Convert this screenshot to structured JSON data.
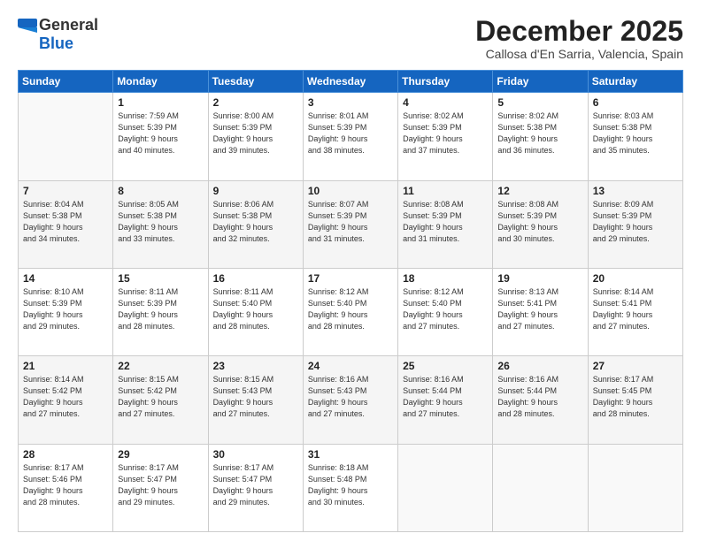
{
  "header": {
    "logo_general": "General",
    "logo_blue": "Blue",
    "month": "December 2025",
    "location": "Callosa d'En Sarria, Valencia, Spain"
  },
  "days_header": [
    "Sunday",
    "Monday",
    "Tuesday",
    "Wednesday",
    "Thursday",
    "Friday",
    "Saturday"
  ],
  "weeks": [
    {
      "shade": false,
      "days": [
        {
          "num": "",
          "info": ""
        },
        {
          "num": "1",
          "info": "Sunrise: 7:59 AM\nSunset: 5:39 PM\nDaylight: 9 hours\nand 40 minutes."
        },
        {
          "num": "2",
          "info": "Sunrise: 8:00 AM\nSunset: 5:39 PM\nDaylight: 9 hours\nand 39 minutes."
        },
        {
          "num": "3",
          "info": "Sunrise: 8:01 AM\nSunset: 5:39 PM\nDaylight: 9 hours\nand 38 minutes."
        },
        {
          "num": "4",
          "info": "Sunrise: 8:02 AM\nSunset: 5:39 PM\nDaylight: 9 hours\nand 37 minutes."
        },
        {
          "num": "5",
          "info": "Sunrise: 8:02 AM\nSunset: 5:38 PM\nDaylight: 9 hours\nand 36 minutes."
        },
        {
          "num": "6",
          "info": "Sunrise: 8:03 AM\nSunset: 5:38 PM\nDaylight: 9 hours\nand 35 minutes."
        }
      ]
    },
    {
      "shade": true,
      "days": [
        {
          "num": "7",
          "info": "Sunrise: 8:04 AM\nSunset: 5:38 PM\nDaylight: 9 hours\nand 34 minutes."
        },
        {
          "num": "8",
          "info": "Sunrise: 8:05 AM\nSunset: 5:38 PM\nDaylight: 9 hours\nand 33 minutes."
        },
        {
          "num": "9",
          "info": "Sunrise: 8:06 AM\nSunset: 5:38 PM\nDaylight: 9 hours\nand 32 minutes."
        },
        {
          "num": "10",
          "info": "Sunrise: 8:07 AM\nSunset: 5:39 PM\nDaylight: 9 hours\nand 31 minutes."
        },
        {
          "num": "11",
          "info": "Sunrise: 8:08 AM\nSunset: 5:39 PM\nDaylight: 9 hours\nand 31 minutes."
        },
        {
          "num": "12",
          "info": "Sunrise: 8:08 AM\nSunset: 5:39 PM\nDaylight: 9 hours\nand 30 minutes."
        },
        {
          "num": "13",
          "info": "Sunrise: 8:09 AM\nSunset: 5:39 PM\nDaylight: 9 hours\nand 29 minutes."
        }
      ]
    },
    {
      "shade": false,
      "days": [
        {
          "num": "14",
          "info": "Sunrise: 8:10 AM\nSunset: 5:39 PM\nDaylight: 9 hours\nand 29 minutes."
        },
        {
          "num": "15",
          "info": "Sunrise: 8:11 AM\nSunset: 5:39 PM\nDaylight: 9 hours\nand 28 minutes."
        },
        {
          "num": "16",
          "info": "Sunrise: 8:11 AM\nSunset: 5:40 PM\nDaylight: 9 hours\nand 28 minutes."
        },
        {
          "num": "17",
          "info": "Sunrise: 8:12 AM\nSunset: 5:40 PM\nDaylight: 9 hours\nand 28 minutes."
        },
        {
          "num": "18",
          "info": "Sunrise: 8:12 AM\nSunset: 5:40 PM\nDaylight: 9 hours\nand 27 minutes."
        },
        {
          "num": "19",
          "info": "Sunrise: 8:13 AM\nSunset: 5:41 PM\nDaylight: 9 hours\nand 27 minutes."
        },
        {
          "num": "20",
          "info": "Sunrise: 8:14 AM\nSunset: 5:41 PM\nDaylight: 9 hours\nand 27 minutes."
        }
      ]
    },
    {
      "shade": true,
      "days": [
        {
          "num": "21",
          "info": "Sunrise: 8:14 AM\nSunset: 5:42 PM\nDaylight: 9 hours\nand 27 minutes."
        },
        {
          "num": "22",
          "info": "Sunrise: 8:15 AM\nSunset: 5:42 PM\nDaylight: 9 hours\nand 27 minutes."
        },
        {
          "num": "23",
          "info": "Sunrise: 8:15 AM\nSunset: 5:43 PM\nDaylight: 9 hours\nand 27 minutes."
        },
        {
          "num": "24",
          "info": "Sunrise: 8:16 AM\nSunset: 5:43 PM\nDaylight: 9 hours\nand 27 minutes."
        },
        {
          "num": "25",
          "info": "Sunrise: 8:16 AM\nSunset: 5:44 PM\nDaylight: 9 hours\nand 27 minutes."
        },
        {
          "num": "26",
          "info": "Sunrise: 8:16 AM\nSunset: 5:44 PM\nDaylight: 9 hours\nand 28 minutes."
        },
        {
          "num": "27",
          "info": "Sunrise: 8:17 AM\nSunset: 5:45 PM\nDaylight: 9 hours\nand 28 minutes."
        }
      ]
    },
    {
      "shade": false,
      "days": [
        {
          "num": "28",
          "info": "Sunrise: 8:17 AM\nSunset: 5:46 PM\nDaylight: 9 hours\nand 28 minutes."
        },
        {
          "num": "29",
          "info": "Sunrise: 8:17 AM\nSunset: 5:47 PM\nDaylight: 9 hours\nand 29 minutes."
        },
        {
          "num": "30",
          "info": "Sunrise: 8:17 AM\nSunset: 5:47 PM\nDaylight: 9 hours\nand 29 minutes."
        },
        {
          "num": "31",
          "info": "Sunrise: 8:18 AM\nSunset: 5:48 PM\nDaylight: 9 hours\nand 30 minutes."
        },
        {
          "num": "",
          "info": ""
        },
        {
          "num": "",
          "info": ""
        },
        {
          "num": "",
          "info": ""
        }
      ]
    }
  ]
}
